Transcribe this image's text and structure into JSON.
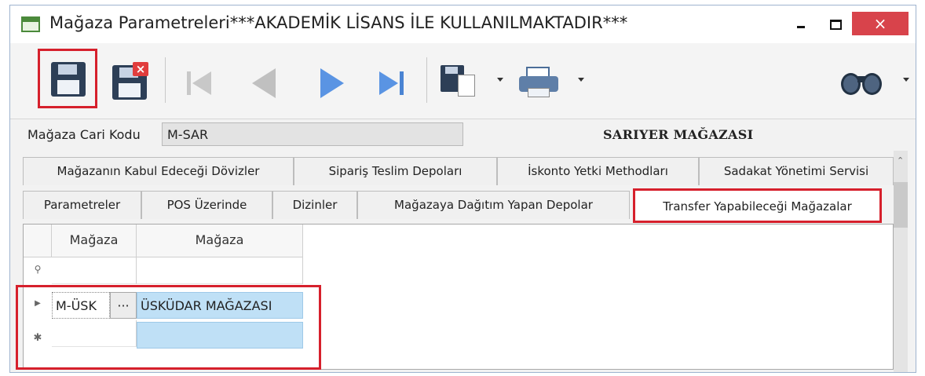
{
  "window": {
    "title": "Mağaza Parametreleri***AKADEMİK LİSANS İLE KULLANILMAKTADIR***",
    "close_label": "×"
  },
  "toolbar": {
    "buttons": [
      "save",
      "delete",
      "first",
      "previous",
      "next",
      "last",
      "export",
      "print",
      "find"
    ]
  },
  "store": {
    "code_label": "Mağaza Cari Kodu",
    "code_value": "M-SAR",
    "name": "SARIYER MAĞAZASI"
  },
  "tabs": {
    "row1": [
      "Mağazanın Kabul Edeceği Dövizler",
      "Sipariş Teslim Depoları",
      "İskonto Yetki Methodları",
      "Sadakat Yönetimi Servisi"
    ],
    "row2": [
      "Parametreler",
      "POS Üzerinde",
      "Dizinler",
      "Mağazaya Dağıtım Yapan Depolar",
      "Transfer Yapabileceği Mağazalar"
    ],
    "active": "Transfer Yapabileceği Mağazalar"
  },
  "grid": {
    "columns": [
      "Mağaza",
      "Mağaza"
    ],
    "rows": [
      {
        "code": "M-ÜSK",
        "ellipsis": "···",
        "name": "ÜSKÜDAR MAĞAZASI"
      }
    ],
    "new_row": {
      "code": "",
      "name": ""
    }
  },
  "colors": {
    "highlight": "#d6202c",
    "selected_cell": "#bfe0f6",
    "close_button": "#d8434b"
  }
}
